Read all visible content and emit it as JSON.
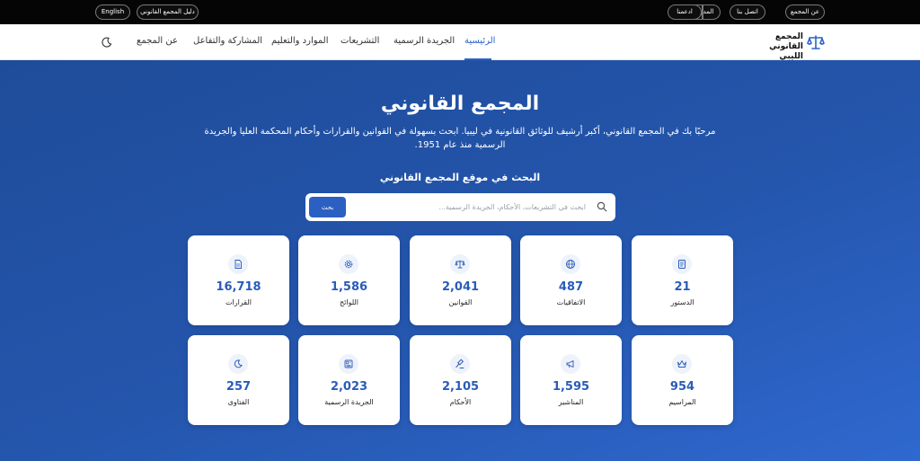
{
  "topbar": {
    "about": "عن المجمع",
    "contact": "اتصل بنا",
    "blog": "المدونة",
    "support": "ادعمنا",
    "guide": "دليل المجمع القانوني",
    "language": "English"
  },
  "nav": {
    "logo_line1": "المجمع",
    "logo_line2": "القانوني الليبي",
    "items": [
      "الرئيسية",
      "الجريدة الرسمية",
      "التشريعات",
      "الموارد والتعليم",
      "المشاركة والتفاعل",
      "عن المجمع"
    ]
  },
  "hero": {
    "title": "المجمع القانوني",
    "subtitle": "مرحبًا بك في المجمع القانوني، أكبر أرشيف للوثائق القانونية في ليبيا. ابحث بسهولة في القوانين والقرارات وأحكام المحكمة العليا والجريدة الرسمية منذ عام 1951.",
    "search_heading": "البحث في موقع المجمع القانوني",
    "search_placeholder": "ابحث في التشريعات، الأحكام، الجريدة الرسمية...",
    "search_button": "بحث"
  },
  "stats": [
    {
      "count": "21",
      "label": "الدستور",
      "icon": "book-icon"
    },
    {
      "count": "487",
      "label": "الاتفاقيات",
      "icon": "globe-icon"
    },
    {
      "count": "2,041",
      "label": "القوانين",
      "icon": "scales-icon"
    },
    {
      "count": "1,586",
      "label": "اللوائح",
      "icon": "gear-icon"
    },
    {
      "count": "16,718",
      "label": "القرارات",
      "icon": "document-icon"
    },
    {
      "count": "954",
      "label": "المراسيم",
      "icon": "crown-icon"
    },
    {
      "count": "1,595",
      "label": "المناشير",
      "icon": "megaphone-icon"
    },
    {
      "count": "2,105",
      "label": "الأحكام",
      "icon": "gavel-icon"
    },
    {
      "count": "2,023",
      "label": "الجريدة الرسمية",
      "icon": "newspaper-icon"
    },
    {
      "count": "257",
      "label": "الفتاوى",
      "icon": "moon-icon"
    }
  ],
  "colors": {
    "accent": "#2a64c6",
    "hero_start": "#1f4c9a",
    "hero_end": "#2f68cf",
    "count_text": "#2a5cb8"
  }
}
